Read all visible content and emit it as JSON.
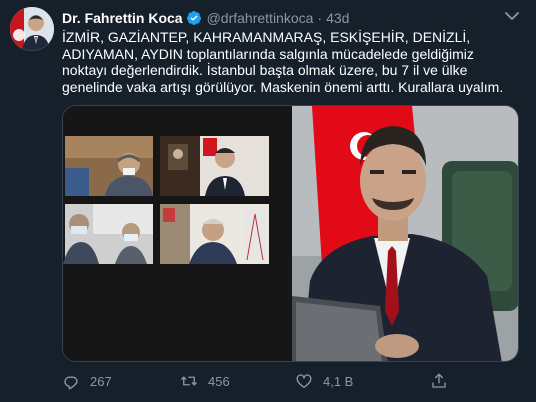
{
  "tweet": {
    "author_name": "Dr. Fahrettin Koca",
    "handle": "@drfahrettinkoca",
    "separator": "·",
    "time": "43d",
    "verified_icon": "verified-badge-icon",
    "text": "İZMİR, GAZİANTEP, KAHRAMANMARAŞ, ESKİŞEHİR, DENİZLİ, ADIYAMAN, AYDIN toplantılarında salgınla mücadelede geldiğimiz noktayı değerlendirdik. İstanbul başta olmak üzere, bu 7 il ve ülke genelinde vaka artışı görülüyor. Maskenin önemi arttı. Kurallara uyalım."
  },
  "actions": {
    "reply_count": "267",
    "retweet_count": "456",
    "like_count": "4,1 B",
    "icons": [
      "reply-icon",
      "retweet-icon",
      "like-icon",
      "share-icon"
    ]
  },
  "colors": {
    "background": "#15202b",
    "secondary_text": "#8899a6",
    "verified": "#1da1f2",
    "border": "#38444d",
    "flag_red": "#e30a17"
  }
}
